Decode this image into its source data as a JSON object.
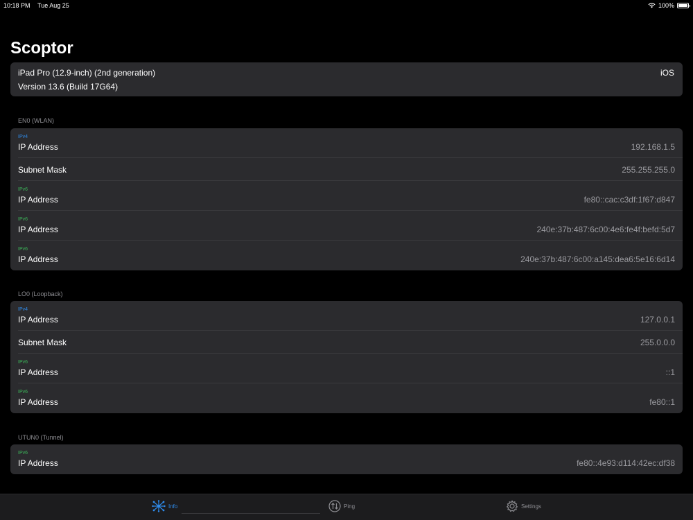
{
  "status_bar": {
    "time": "10:18 PM",
    "date": "Tue Aug 25",
    "battery": "100%",
    "battery_level": 1.0
  },
  "app": {
    "title": "Scoptor"
  },
  "device": {
    "model": "iPad Pro (12.9-inch) (2nd generation)",
    "version": "Version 13.6 (Build 17G64)",
    "os": "iOS"
  },
  "sections": [
    {
      "header": "EN0 (WLAN)",
      "rows": [
        {
          "tag": "IPv4",
          "label": "IP Address",
          "value": "192.168.1.5"
        },
        {
          "tag": "",
          "label": "Subnet Mask",
          "value": "255.255.255.0"
        },
        {
          "tag": "IPv6",
          "label": "IP Address",
          "value": "fe80::cac:c3df:1f67:d847"
        },
        {
          "tag": "IPv6",
          "label": "IP Address",
          "value": "240e:37b:487:6c00:4e6:fe4f:befd:5d7"
        },
        {
          "tag": "IPv6",
          "label": "IP Address",
          "value": "240e:37b:487:6c00:a145:dea6:5e16:6d14"
        }
      ]
    },
    {
      "header": "LO0 (Loopback)",
      "rows": [
        {
          "tag": "IPv4",
          "label": "IP Address",
          "value": "127.0.0.1"
        },
        {
          "tag": "",
          "label": "Subnet Mask",
          "value": "255.0.0.0"
        },
        {
          "tag": "IPv6",
          "label": "IP Address",
          "value": "::1"
        },
        {
          "tag": "IPv6",
          "label": "IP Address",
          "value": "fe80::1"
        }
      ]
    },
    {
      "header": "UTUN0 (Tunnel)",
      "rows": [
        {
          "tag": "IPv6",
          "label": "IP Address",
          "value": "fe80::4e93:d114:42ec:df38"
        }
      ]
    }
  ],
  "tabs": [
    {
      "label": "Info",
      "icon": "network-icon",
      "active": true
    },
    {
      "label": "Ping",
      "icon": "ping-icon",
      "active": false
    },
    {
      "label": "Settings",
      "icon": "gear-icon",
      "active": false
    }
  ],
  "colors": {
    "accent": "#2f8bea",
    "ipv6": "#3cb55a",
    "card": "#2b2b2e",
    "background": "#000000"
  }
}
